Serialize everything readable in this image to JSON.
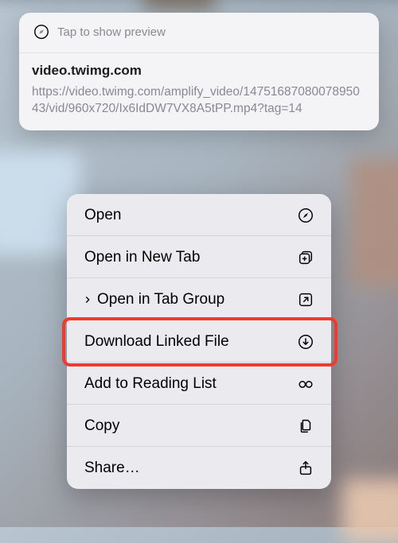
{
  "preview": {
    "tap_hint": "Tap to show preview",
    "domain": "video.twimg.com",
    "url": "https://video.twimg.com/amplify_video/1475168708007895043/vid/960x720/Ix6IdDW7VX8A5tPP.mp4?tag=14"
  },
  "menu": {
    "open": "Open",
    "open_new_tab": "Open in New Tab",
    "open_tab_group": "Open in Tab Group",
    "download": "Download Linked File",
    "reading_list": "Add to Reading List",
    "copy": "Copy",
    "share": "Share…"
  },
  "highlight_index": 3
}
